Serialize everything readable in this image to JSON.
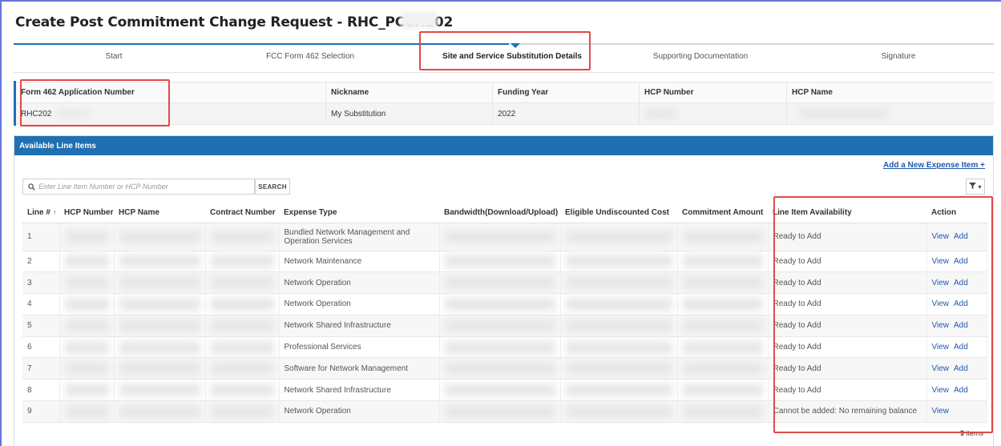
{
  "page": {
    "title": "Create Post Commitment Change Request - RHC_PCCR202"
  },
  "steps": [
    {
      "label": "Start"
    },
    {
      "label": "FCC Form 462 Selection"
    },
    {
      "label": "Site and Service Substitution Details"
    },
    {
      "label": "Supporting Documentation"
    },
    {
      "label": "Signature"
    }
  ],
  "application_info": {
    "headers": [
      "Form 462 Application Number",
      "Nickname",
      "Funding Year",
      "HCP Number",
      "HCP Name"
    ],
    "values": {
      "application_number": "RHC202",
      "nickname": "My Substitution",
      "funding_year": "2022"
    }
  },
  "line_items_panel": {
    "title": "Available Line Items",
    "add_link": "Add a New Expense Item +",
    "search_placeholder": "Enter Line Item Number or HCP Number",
    "search_button": "SEARCH",
    "filter_caret": "▾",
    "sort_indicator": "↑",
    "columns": [
      "Line #",
      "HCP Number",
      "HCP Name",
      "Contract Number",
      "Expense Type",
      "Bandwidth(Download/Upload)",
      "Eligible Undiscounted Cost",
      "Commitment Amount",
      "Line Item Availability",
      "Action"
    ],
    "rows": [
      {
        "line": "1",
        "expense_type": "Bundled Network Management and Operation Services",
        "availability": "Ready to Add",
        "view": "View",
        "add": "Add"
      },
      {
        "line": "2",
        "expense_type": "Network Maintenance",
        "availability": "Ready to Add",
        "view": "View",
        "add": "Add"
      },
      {
        "line": "3",
        "expense_type": "Network Operation",
        "availability": "Ready to Add",
        "view": "View",
        "add": "Add"
      },
      {
        "line": "4",
        "expense_type": "Network Operation",
        "availability": "Ready to Add",
        "view": "View",
        "add": "Add"
      },
      {
        "line": "5",
        "expense_type": "Network Shared Infrastructure",
        "availability": "Ready to Add",
        "view": "View",
        "add": "Add"
      },
      {
        "line": "6",
        "expense_type": "Professional Services",
        "availability": "Ready to Add",
        "view": "View",
        "add": "Add"
      },
      {
        "line": "7",
        "expense_type": "Software for Network Management",
        "availability": "Ready to Add",
        "view": "View",
        "add": "Add"
      },
      {
        "line": "8",
        "expense_type": "Network Shared Infrastructure",
        "availability": "Ready to Add",
        "view": "View",
        "add": "Add"
      },
      {
        "line": "9",
        "expense_type": "Network Operation",
        "availability": "Cannot be added: No remaining balance",
        "view": "View",
        "add": ""
      }
    ],
    "items_count": "9",
    "items_label": "items"
  },
  "colors": {
    "primary": "#1f6fb2",
    "link": "#1f5aa8",
    "highlight": "#e04a4a"
  },
  "icons": [
    "search-icon",
    "filter-icon",
    "sort-ascending-icon"
  ]
}
